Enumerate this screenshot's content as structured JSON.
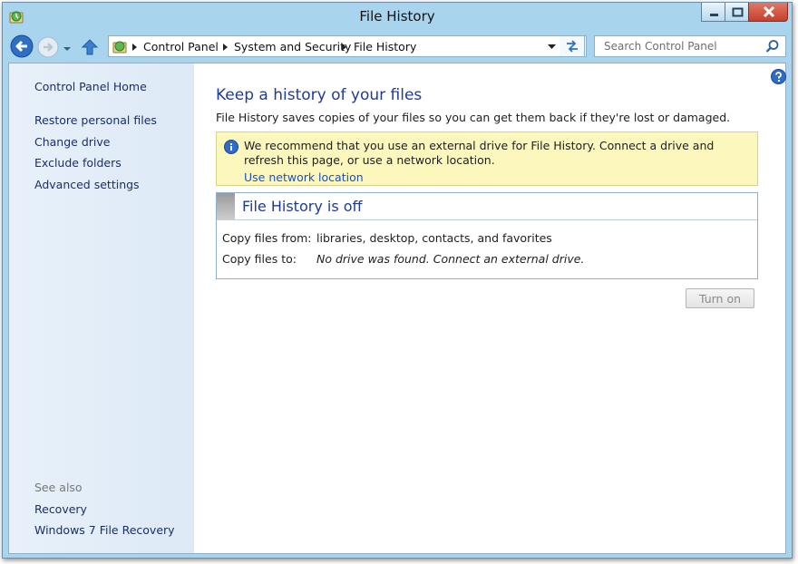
{
  "window": {
    "title": "File History"
  },
  "address_bar": {
    "breadcrumbs": [
      "Control Panel",
      "System and Security",
      "File History"
    ]
  },
  "search": {
    "placeholder": "Search Control Panel"
  },
  "sidebar": {
    "home": "Control Panel Home",
    "links": [
      "Restore personal files",
      "Change drive",
      "Exclude folders",
      "Advanced settings"
    ],
    "see_also_heading": "See also",
    "see_also": [
      "Recovery",
      "Windows 7 File Recovery"
    ]
  },
  "main": {
    "title": "Keep a history of your files",
    "description": "File History saves copies of your files so you can get them back if they're lost or damaged.",
    "warning": {
      "text": "We recommend that you use an external drive for File History. Connect a drive and refresh this page, or use a network location.",
      "link": "Use network location"
    },
    "status_box": {
      "title": "File History is off",
      "rows": [
        {
          "label": "Copy files from:",
          "value": "libraries, desktop, contacts, and favorites"
        },
        {
          "label": "Copy files to:",
          "value": "No drive was found. Connect an external drive."
        }
      ]
    },
    "turn_on_button": "Turn on"
  },
  "colors": {
    "window_frame": "#a8d4ee",
    "link": "#1b2d6b",
    "heading": "#1e3c96",
    "warning_background": "#fbf7bd",
    "close_button": "#c5402b"
  },
  "icons": [
    "control-panel-icon",
    "minimize-icon",
    "maximize-icon",
    "close-icon",
    "back-arrow-icon",
    "forward-arrow-icon",
    "recent-pages-chevron-icon",
    "up-arrow-icon",
    "breadcrumb-arrow-icon",
    "dropdown-arrow-icon",
    "refresh-icon",
    "search-icon",
    "help-icon",
    "info-icon"
  ]
}
